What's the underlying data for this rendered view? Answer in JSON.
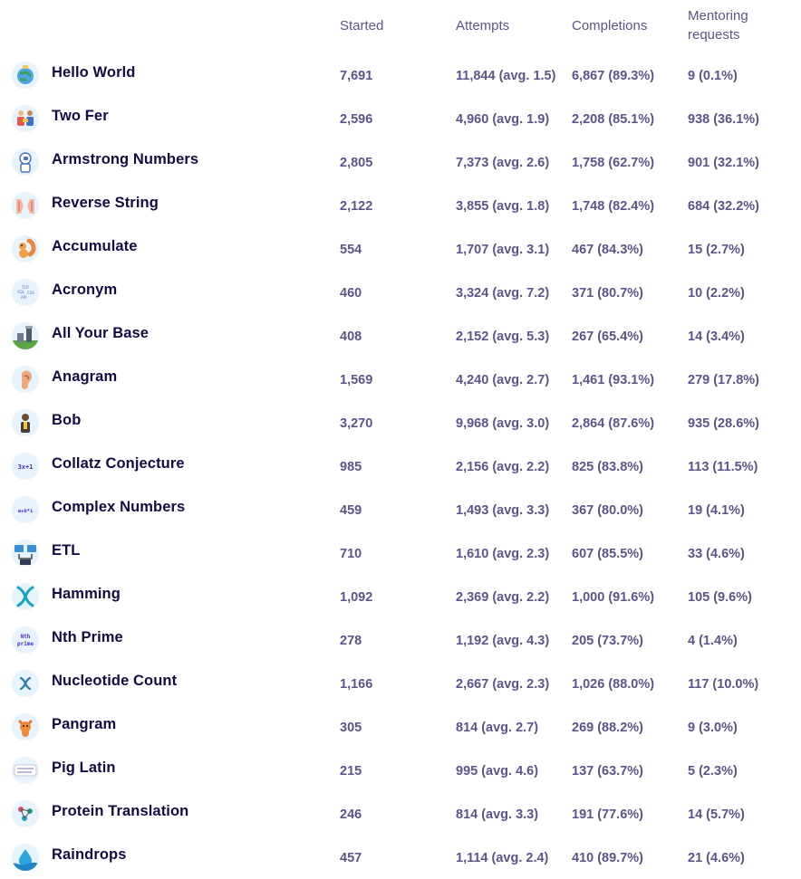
{
  "headers": {
    "started": "Started",
    "attempts": "Attempts",
    "completions": "Completions",
    "mentoring": "Mentoring requests"
  },
  "rows": [
    {
      "name": "Hello World",
      "icon": "globe-icon",
      "started": "7,691",
      "attempts": "11,844 (avg. 1.5)",
      "completions": "6,867 (89.3%)",
      "mentoring": "9 (0.1%)"
    },
    {
      "name": "Two Fer",
      "icon": "people-exchange-icon",
      "started": "2,596",
      "attempts": "4,960 (avg. 1.9)",
      "completions": "2,208 (85.1%)",
      "mentoring": "938 (36.1%)"
    },
    {
      "name": "Armstrong Numbers",
      "icon": "astronaut-icon",
      "started": "2,805",
      "attempts": "7,373 (avg. 2.6)",
      "completions": "1,758 (62.7%)",
      "mentoring": "901 (32.1%)"
    },
    {
      "name": "Reverse String",
      "icon": "hands-icon",
      "started": "2,122",
      "attempts": "3,855 (avg. 1.8)",
      "completions": "1,748 (82.4%)",
      "mentoring": "684 (32.2%)"
    },
    {
      "name": "Accumulate",
      "icon": "squirrel-icon",
      "started": "554",
      "attempts": "1,707 (avg. 3.1)",
      "completions": "467 (84.3%)",
      "mentoring": "15 (2.7%)"
    },
    {
      "name": "Acronym",
      "icon": "acronym-icon",
      "started": "460",
      "attempts": "3,324 (avg. 7.2)",
      "completions": "371 (80.7%)",
      "mentoring": "10 (2.2%)"
    },
    {
      "name": "All Your Base",
      "icon": "base-tower-icon",
      "started": "408",
      "attempts": "2,152 (avg. 5.3)",
      "completions": "267 (65.4%)",
      "mentoring": "14 (3.4%)"
    },
    {
      "name": "Anagram",
      "icon": "ear-icon",
      "started": "1,569",
      "attempts": "4,240 (avg. 2.7)",
      "completions": "1,461 (93.1%)",
      "mentoring": "279 (17.8%)"
    },
    {
      "name": "Bob",
      "icon": "bob-icon",
      "started": "3,270",
      "attempts": "9,968 (avg. 3.0)",
      "completions": "2,864 (87.6%)",
      "mentoring": "935 (28.6%)"
    },
    {
      "name": "Collatz Conjecture",
      "icon": "collatz-icon",
      "icon_text": "3x+1",
      "started": "985",
      "attempts": "2,156 (avg. 2.2)",
      "completions": "825 (83.8%)",
      "mentoring": "113 (11.5%)"
    },
    {
      "name": "Complex Numbers",
      "icon": "complex-numbers-icon",
      "icon_text": "a+b*i",
      "started": "459",
      "attempts": "1,493 (avg. 3.3)",
      "completions": "367 (80.0%)",
      "mentoring": "19 (4.1%)"
    },
    {
      "name": "ETL",
      "icon": "etl-icon",
      "started": "710",
      "attempts": "1,610 (avg. 2.3)",
      "completions": "607 (85.5%)",
      "mentoring": "33 (4.6%)"
    },
    {
      "name": "Hamming",
      "icon": "dna-icon",
      "started": "1,092",
      "attempts": "2,369 (avg. 2.2)",
      "completions": "1,000 (91.6%)",
      "mentoring": "105 (9.6%)"
    },
    {
      "name": "Nth Prime",
      "icon": "nth-prime-icon",
      "icon_text": "Nth prime",
      "started": "278",
      "attempts": "1,192 (avg. 4.3)",
      "completions": "205 (73.7%)",
      "mentoring": "4 (1.4%)"
    },
    {
      "name": "Nucleotide Count",
      "icon": "nucleotide-icon",
      "started": "1,166",
      "attempts": "2,667 (avg. 2.3)",
      "completions": "1,026 (88.0%)",
      "mentoring": "117 (10.0%)"
    },
    {
      "name": "Pangram",
      "icon": "fox-icon",
      "started": "305",
      "attempts": "814 (avg. 2.7)",
      "completions": "269 (88.2%)",
      "mentoring": "9 (3.0%)"
    },
    {
      "name": "Pig Latin",
      "icon": "pig-latin-icon",
      "started": "215",
      "attempts": "995 (avg. 4.6)",
      "completions": "137 (63.7%)",
      "mentoring": "5 (2.3%)"
    },
    {
      "name": "Protein Translation",
      "icon": "protein-icon",
      "started": "246",
      "attempts": "814 (avg. 3.3)",
      "completions": "191 (77.6%)",
      "mentoring": "14 (5.7%)"
    },
    {
      "name": "Raindrops",
      "icon": "raindrop-icon",
      "started": "457",
      "attempts": "1,114 (avg. 2.4)",
      "completions": "410 (89.7%)",
      "mentoring": "21 (4.6%)"
    }
  ]
}
